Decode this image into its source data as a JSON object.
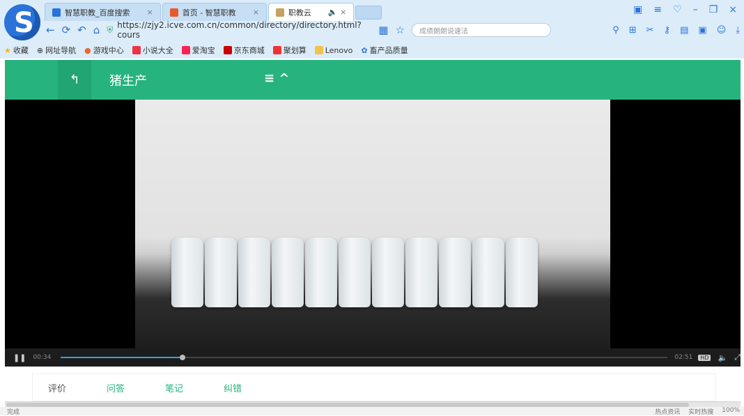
{
  "browser": {
    "tabs": [
      {
        "label": "智慧职教_百度搜索",
        "icon": "baidu-icon",
        "active": false
      },
      {
        "label": "首页 - 智慧职教",
        "icon": "icve-icon",
        "active": false
      },
      {
        "label": "职教云",
        "icon": "zjy-icon",
        "active": true
      }
    ],
    "url": "https://zjy2.icve.com.cn/common/directory/directory.html?cours",
    "search_placeholder": "成绩朗朗说速法",
    "bookmarks": [
      {
        "label": "收藏",
        "icon": "star-icon"
      },
      {
        "label": "网址导航",
        "icon": "globe-icon"
      },
      {
        "label": "游戏中心",
        "icon": "game-icon"
      },
      {
        "label": "小说大全",
        "icon": "book-icon"
      },
      {
        "label": "爱淘宝",
        "icon": "taobao-icon"
      },
      {
        "label": "京东商城",
        "icon": "jd-icon"
      },
      {
        "label": "聚划算",
        "icon": "juhuasuan-icon"
      },
      {
        "label": "Lenovo",
        "icon": "folder-icon"
      },
      {
        "label": "畜产品质量",
        "icon": "leaf-icon"
      }
    ]
  },
  "header": {
    "back_icon": "↰",
    "title": "猪生产",
    "menu_icon": "≡ ^"
  },
  "player": {
    "current_time": "00:34",
    "duration": "02:51",
    "progress": 0.2,
    "hd_label": "HD"
  },
  "bottom_tabs": [
    "评价",
    "问答",
    "笔记",
    "纠错"
  ],
  "status": {
    "left": "完成",
    "right": [
      "热点资讯",
      "实时热搜",
      "100%"
    ]
  },
  "colors": {
    "header_green": "#27b37e",
    "tab_green": "#27b37e"
  }
}
